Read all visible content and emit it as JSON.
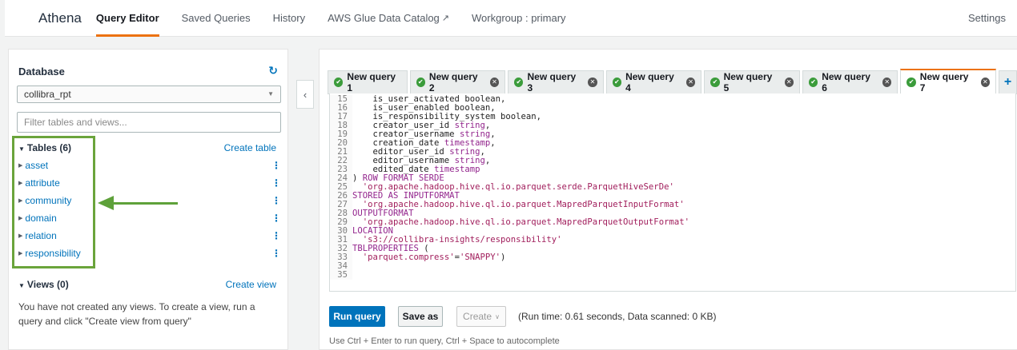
{
  "nav": {
    "brand": "Athena",
    "items": [
      {
        "label": "Query Editor",
        "active": true
      },
      {
        "label": "Saved Queries",
        "active": false
      },
      {
        "label": "History",
        "active": false
      },
      {
        "label": "AWS Glue Data Catalog",
        "active": false,
        "external": true
      }
    ],
    "workgroup": "Workgroup : primary",
    "settings": "Settings"
  },
  "sidebar": {
    "database_title": "Database",
    "refresh_icon": "refresh-icon",
    "selected_database": "collibra_rpt",
    "filter_placeholder": "Filter tables and views...",
    "tables_heading": "Tables (6)",
    "create_table": "Create table",
    "tables": [
      "asset",
      "attribute",
      "community",
      "domain",
      "relation",
      "responsibility"
    ],
    "views_heading": "Views (0)",
    "create_view": "Create view",
    "views_empty": "You have not created any views. To create a view, run a query and click \"Create view from query\""
  },
  "annotation": {
    "highlight_color": "#6aa43b",
    "arrow_color": "#5ea13a"
  },
  "tabs": [
    {
      "label": "New query 1",
      "closable": false,
      "active": false
    },
    {
      "label": "New query 2",
      "closable": true,
      "active": false
    },
    {
      "label": "New query 3",
      "closable": true,
      "active": false
    },
    {
      "label": "New query 4",
      "closable": true,
      "active": false
    },
    {
      "label": "New query 5",
      "closable": true,
      "active": false
    },
    {
      "label": "New query 6",
      "closable": true,
      "active": false
    },
    {
      "label": "New query 7",
      "closable": true,
      "active": true
    }
  ],
  "editor": {
    "lines": [
      {
        "n": "15",
        "parts": [
          [
            "txt",
            "    is_user_activated boolean,"
          ]
        ]
      },
      {
        "n": "16",
        "parts": [
          [
            "txt",
            "    is_user_enabled boolean,"
          ]
        ]
      },
      {
        "n": "17",
        "parts": [
          [
            "txt",
            "    is_responsibility_system boolean,"
          ]
        ]
      },
      {
        "n": "18",
        "parts": [
          [
            "txt",
            "    creator_user_id "
          ],
          [
            "kw",
            "string"
          ],
          [
            "txt",
            ","
          ]
        ]
      },
      {
        "n": "19",
        "parts": [
          [
            "txt",
            "    creator_username "
          ],
          [
            "kw",
            "string"
          ],
          [
            "txt",
            ","
          ]
        ]
      },
      {
        "n": "20",
        "parts": [
          [
            "txt",
            "    creation_date "
          ],
          [
            "kw",
            "timestamp"
          ],
          [
            "txt",
            ","
          ]
        ]
      },
      {
        "n": "21",
        "parts": [
          [
            "txt",
            "    editor_user_id "
          ],
          [
            "kw",
            "string"
          ],
          [
            "txt",
            ","
          ]
        ]
      },
      {
        "n": "22",
        "parts": [
          [
            "txt",
            "    editor_username "
          ],
          [
            "kw",
            "string"
          ],
          [
            "txt",
            ","
          ]
        ]
      },
      {
        "n": "23",
        "parts": [
          [
            "txt",
            "    edited_date "
          ],
          [
            "kw",
            "timestamp"
          ]
        ]
      },
      {
        "n": "24",
        "parts": [
          [
            "txt",
            ") "
          ],
          [
            "kw",
            "ROW FORMAT SERDE"
          ]
        ]
      },
      {
        "n": "25",
        "parts": [
          [
            "txt",
            "  "
          ],
          [
            "str",
            "'org.apache.hadoop.hive.ql.io.parquet.serde.ParquetHiveSerDe'"
          ]
        ]
      },
      {
        "n": "26",
        "parts": [
          [
            "kw",
            "STORED AS INPUTFORMAT"
          ]
        ]
      },
      {
        "n": "27",
        "parts": [
          [
            "txt",
            "  "
          ],
          [
            "str",
            "'org.apache.hadoop.hive.ql.io.parquet.MapredParquetInputFormat'"
          ]
        ]
      },
      {
        "n": "28",
        "parts": [
          [
            "kw",
            "OUTPUTFORMAT"
          ]
        ]
      },
      {
        "n": "29",
        "parts": [
          [
            "txt",
            "  "
          ],
          [
            "str",
            "'org.apache.hadoop.hive.ql.io.parquet.MapredParquetOutputFormat'"
          ]
        ]
      },
      {
        "n": "30",
        "parts": [
          [
            "kw",
            "LOCATION"
          ]
        ]
      },
      {
        "n": "31",
        "parts": [
          [
            "txt",
            "  "
          ],
          [
            "str",
            "'s3://collibra-insights/responsibility'"
          ]
        ]
      },
      {
        "n": "32",
        "parts": [
          [
            "kw",
            "TBLPROPERTIES"
          ],
          [
            "txt",
            " ("
          ]
        ]
      },
      {
        "n": "33",
        "parts": [
          [
            "txt",
            "  "
          ],
          [
            "str",
            "'parquet.compress'"
          ],
          [
            "txt",
            "="
          ],
          [
            "str",
            "'SNAPPY'"
          ],
          [
            "txt",
            ")"
          ]
        ]
      },
      {
        "n": "34",
        "parts": []
      },
      {
        "n": "35",
        "parts": []
      }
    ]
  },
  "actions": {
    "run": "Run query",
    "save_as": "Save as",
    "create": "Create",
    "run_info": "(Run time: 0.61 seconds, Data scanned: 0 KB)",
    "hint": "Use Ctrl + Enter to run query, Ctrl + Space to autocomplete"
  },
  "colors": {
    "accent": "#ec7211",
    "link": "#0073bb",
    "success": "#3b9c3b"
  }
}
